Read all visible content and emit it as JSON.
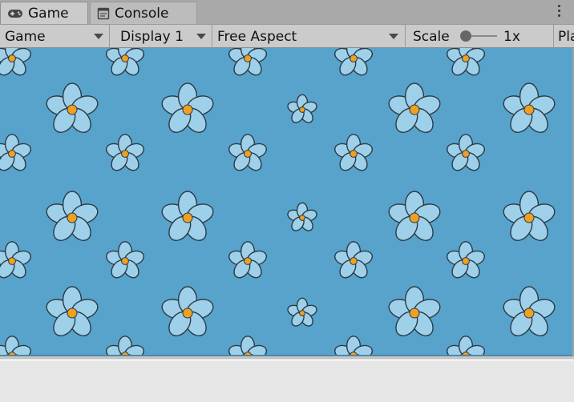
{
  "tabs": [
    {
      "label": "Game",
      "icon": "gamepad-icon",
      "active": true
    },
    {
      "label": "Console",
      "icon": "console-icon",
      "active": false
    }
  ],
  "toolbar": {
    "view_select": "Game",
    "display_select": "Display 1",
    "aspect_select": "Free Aspect",
    "scale_label": "Scale",
    "scale_value": "1x",
    "play_label": "Pla"
  },
  "colors": {
    "game_background": "#57a3cc",
    "petal": "#9fd0ea",
    "flower_center": "#f0a020",
    "outline": "#2b3a44"
  }
}
